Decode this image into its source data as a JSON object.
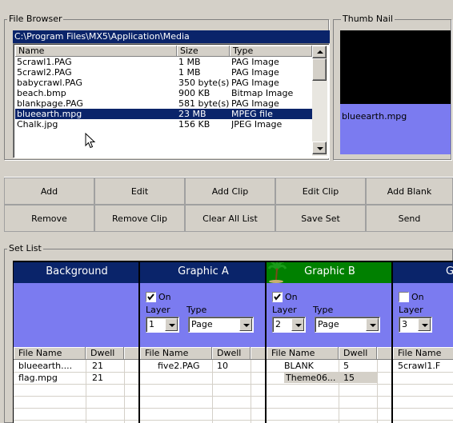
{
  "file_browser": {
    "legend": "File Browser",
    "path": "C:\\Program Files\\MX5\\Application\\Media",
    "columns": [
      "Name",
      "Size",
      "Type"
    ],
    "rows": [
      {
        "name": "5crawl1.PAG",
        "size": "1 MB",
        "type": "PAG Image"
      },
      {
        "name": "5crawl2.PAG",
        "size": "1 MB",
        "type": "PAG Image"
      },
      {
        "name": "babycrawl.PAG",
        "size": "350 byte(s)",
        "type": "PAG Image"
      },
      {
        "name": "beach.bmp",
        "size": "900 KB",
        "type": "Bitmap Image"
      },
      {
        "name": "blankpage.PAG",
        "size": "581 byte(s)",
        "type": "PAG Image"
      },
      {
        "name": "blueearth.mpg",
        "size": "23 MB",
        "type": "MPEG file",
        "selected": true
      },
      {
        "name": "Chalk.jpg",
        "size": "156 KB",
        "type": "JPEG Image"
      }
    ]
  },
  "thumbnail": {
    "legend": "Thumb Nail",
    "caption": "blueearth.mpg"
  },
  "buttons": {
    "row1": [
      "Add",
      "Edit",
      "Add Clip",
      "Edit Clip",
      "Add Blank"
    ],
    "row2": [
      "Remove",
      "Remove Clip",
      "Clear All List",
      "Save Set",
      "Send"
    ]
  },
  "set_list": {
    "legend": "Set List",
    "columns": [
      {
        "title": "Background",
        "color": "#0a246a",
        "has_controls": false,
        "sub_headers": [
          "File Name",
          "Dwell"
        ],
        "rows": [
          {
            "file": "blueearth....",
            "dwell": "21"
          },
          {
            "file": "flag.mpg",
            "dwell": "21"
          }
        ]
      },
      {
        "title": "Graphic A",
        "color": "#0a246a",
        "has_controls": true,
        "on_checked": true,
        "on_label": "On",
        "layer_label": "Layer",
        "type_label": "Type",
        "layer_value": "1",
        "type_value": "Page",
        "sub_headers": [
          "File Name",
          "Dwell"
        ],
        "rows": [
          {
            "file": "five2.PAG",
            "dwell": "10"
          }
        ]
      },
      {
        "title": "Graphic B",
        "color": "#008000",
        "has_controls": true,
        "on_checked": true,
        "on_label": "On",
        "layer_label": "Layer",
        "type_label": "Type",
        "layer_value": "2",
        "type_value": "Page",
        "sub_headers": [
          "File Name",
          "Dwell"
        ],
        "rows": [
          {
            "file": "BLANK",
            "dwell": "5"
          },
          {
            "file": "Theme06...",
            "dwell": "15"
          }
        ]
      },
      {
        "title": "Grap",
        "color": "#0a246a",
        "has_controls": true,
        "on_checked": false,
        "on_label": "On",
        "layer_label": "Layer",
        "layer_value": "3",
        "sub_headers": [
          "File Name"
        ],
        "rows": [
          {
            "file": "5crawl1.F"
          }
        ]
      }
    ]
  }
}
